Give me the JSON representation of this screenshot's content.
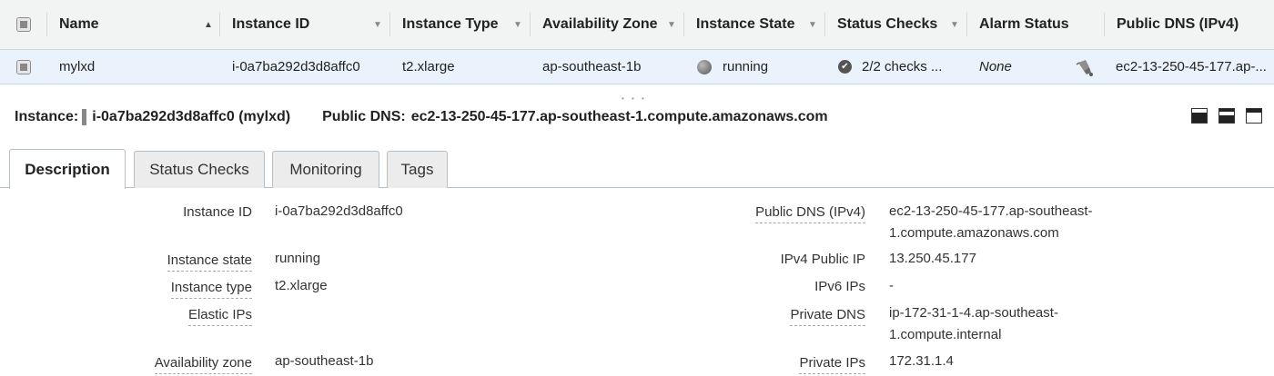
{
  "table": {
    "headers": {
      "name": "Name",
      "instance_id": "Instance ID",
      "instance_type": "Instance Type",
      "availability_zone": "Availability Zone",
      "instance_state": "Instance State",
      "status_checks": "Status Checks",
      "alarm_status": "Alarm Status",
      "public_dns": "Public DNS (IPv4)"
    },
    "row": {
      "name": "mylxd",
      "instance_id": "i-0a7ba292d3d8affc0",
      "instance_type": "t2.xlarge",
      "availability_zone": "ap-southeast-1b",
      "instance_state": "running",
      "status_checks": "2/2 checks ...",
      "alarm_status": "None",
      "public_dns": "ec2-13-250-45-177.ap-..."
    }
  },
  "detail": {
    "instance_label": "Instance:",
    "instance_value": "i-0a7ba292d3d8affc0 (mylxd)",
    "dns_label": "Public DNS:",
    "dns_value": "ec2-13-250-45-177.ap-southeast-1.compute.amazonaws.com"
  },
  "tabs": [
    "Description",
    "Status Checks",
    "Monitoring",
    "Tags"
  ],
  "description": {
    "left": [
      {
        "label": "Instance ID",
        "value": "i-0a7ba292d3d8affc0"
      },
      {
        "label": "Instance state",
        "value": "running"
      },
      {
        "label": "Instance type",
        "value": "t2.xlarge"
      },
      {
        "label": "Elastic IPs",
        "value": ""
      },
      {
        "label": "Availability zone",
        "value": "ap-southeast-1b"
      }
    ],
    "right": [
      {
        "label": "Public DNS (IPv4)",
        "value_line1": "ec2-13-250-45-177.ap-southeast-",
        "value_line2": "1.compute.amazonaws.com"
      },
      {
        "label": "IPv4 Public IP",
        "value": "13.250.45.177"
      },
      {
        "label": "IPv6 IPs",
        "value": "-"
      },
      {
        "label": "Private DNS",
        "value_line1": "ip-172-31-1-4.ap-southeast-",
        "value_line2": "1.compute.internal"
      },
      {
        "label": "Private IPs",
        "value": "172.31.1.4"
      }
    ]
  },
  "colors": {
    "header_bg": "#f2f3f3",
    "selected_row_bg": "#eaf3fb",
    "tab_inactive_bg": "#ececec"
  },
  "icons": {
    "sort_asc": "sort-ascending-icon",
    "sort_menu": "sort-dropdown-icon",
    "state": "instance-state-icon",
    "checks": "status-check-icon",
    "alarm": "alarm-bell-icon"
  }
}
